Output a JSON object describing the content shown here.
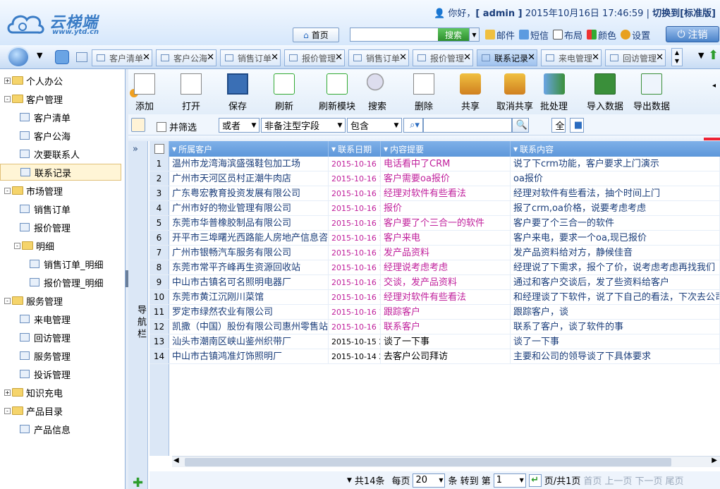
{
  "brand": {
    "name": "云梯端",
    "url": "www.ytd.cn"
  },
  "header": {
    "greeting": "你好，",
    "user": "[ admin ]",
    "datetime": "2015年10月16日 17:46:59",
    "separator": "|",
    "switch_label": "切换到[标准版]",
    "home": "首页",
    "search_placeholder": "",
    "search_button": "搜索",
    "actions": [
      "邮件",
      "短信",
      "布局",
      "颜色",
      "设置"
    ],
    "logout": "注销"
  },
  "tabs": [
    {
      "label": "客户清单"
    },
    {
      "label": "客户公海"
    },
    {
      "label": "销售订单"
    },
    {
      "label": "报价管理"
    },
    {
      "label": "销售订单"
    },
    {
      "label": "报价管理"
    },
    {
      "label": "联系记录",
      "active": true
    },
    {
      "label": "来电管理"
    },
    {
      "label": "回访管理"
    }
  ],
  "sidebar": {
    "items": [
      {
        "label": "个人办公",
        "type": "folder",
        "expand": "+",
        "indent": 0
      },
      {
        "label": "客户管理",
        "type": "folder",
        "expand": "-",
        "indent": 0
      },
      {
        "label": "客户清单",
        "type": "page",
        "indent": 1
      },
      {
        "label": "客户公海",
        "type": "page",
        "indent": 1
      },
      {
        "label": "次要联系人",
        "type": "page",
        "indent": 1
      },
      {
        "label": "联系记录",
        "type": "page",
        "indent": 1,
        "selected": true
      },
      {
        "label": "市场管理",
        "type": "folder",
        "expand": "-",
        "indent": 0
      },
      {
        "label": "销售订单",
        "type": "page",
        "indent": 1
      },
      {
        "label": "报价管理",
        "type": "page",
        "indent": 1
      },
      {
        "label": "明细",
        "type": "folder",
        "expand": "-",
        "indent": 1
      },
      {
        "label": "销售订单_明细",
        "type": "page",
        "indent": 2
      },
      {
        "label": "报价管理_明细",
        "type": "page",
        "indent": 2
      },
      {
        "label": "服务管理",
        "type": "folder",
        "expand": "-",
        "indent": 0
      },
      {
        "label": "来电管理",
        "type": "page",
        "indent": 1
      },
      {
        "label": "回访管理",
        "type": "page",
        "indent": 1
      },
      {
        "label": "服务管理",
        "type": "page",
        "indent": 1
      },
      {
        "label": "投诉管理",
        "type": "page",
        "indent": 1
      },
      {
        "label": "知识充电",
        "type": "folder",
        "expand": "+",
        "indent": 0
      },
      {
        "label": "产品目录",
        "type": "folder",
        "expand": "-",
        "indent": 0
      },
      {
        "label": "产品信息",
        "type": "page",
        "indent": 1
      }
    ]
  },
  "toolbar": {
    "buttons": [
      {
        "label": "添加",
        "icon": "new-document-icon"
      },
      {
        "label": "打开",
        "icon": "edit-document-icon"
      },
      {
        "label": "保存",
        "icon": "floppy-disk-icon"
      },
      {
        "label": "刷新",
        "icon": "refresh-icon"
      },
      {
        "label": "刷新模块",
        "icon": "refresh-module-icon"
      },
      {
        "label": "搜索",
        "icon": "magnifier-icon"
      },
      {
        "label": "删除",
        "icon": "delete-icon"
      },
      {
        "label": "共享",
        "icon": "share-icon"
      },
      {
        "label": "取消共享",
        "icon": "unshare-icon"
      },
      {
        "label": "批处理",
        "icon": "batch-icon"
      },
      {
        "label": "导入数据",
        "icon": "import-excel-icon"
      },
      {
        "label": "导出数据",
        "icon": "export-excel-icon"
      }
    ]
  },
  "filter": {
    "combine_label": "并筛选",
    "logic": "或者",
    "field": "非备注型字段",
    "operator": "包含",
    "value": ""
  },
  "grid": {
    "nav_label": "导航栏",
    "columns": [
      "所属客户",
      "联系日期",
      "内容提要",
      "联系内容"
    ],
    "rows": [
      {
        "n": "1",
        "customer": "温州市龙湾海滨盛强鞋包加工场",
        "date": "2015-10-16",
        "summary": "电话看中了CRM",
        "content": "说了下crm功能，客户要求上门演示",
        "plain": false
      },
      {
        "n": "2",
        "customer": "广州市天河区员村正潮牛肉店",
        "date": "2015-10-16 14",
        "summary": "客户需要oa报价",
        "content": "oa报价",
        "plain": false
      },
      {
        "n": "3",
        "customer": "广东粤宏教育投资发展有限公司",
        "date": "2015-10-16 14",
        "summary": "经理对软件有些看法",
        "content": "经理对软件有些看法，抽个时间上门",
        "plain": false
      },
      {
        "n": "4",
        "customer": "广州市好的物业管理有限公司",
        "date": "2015-10-16 14",
        "summary": "报价",
        "content": "报了crm,oa价格，说要考虑考虑",
        "plain": false
      },
      {
        "n": "5",
        "customer": "东莞市华普橡胶制品有限公司",
        "date": "2015-10-16 14",
        "summary": "客户要了个三合一的软件",
        "content": "客户要了个三合一的软件",
        "plain": false
      },
      {
        "n": "6",
        "customer": "开平市三埠曙光西路能人房地产信息咨",
        "date": "2015-10-16 14",
        "summary": "客户来电",
        "content": "客户来电，要求一个oa,现已报价",
        "plain": false
      },
      {
        "n": "7",
        "customer": "广州市银畅汽车服务有限公司",
        "date": "2015-10-16 14",
        "summary": "发产品资料",
        "content": "发产品资料给对方，静候佳音",
        "plain": false
      },
      {
        "n": "8",
        "customer": "东莞市常平齐峰再生资源回收站",
        "date": "2015-10-16 14",
        "summary": "经理说考虑考虑",
        "content": "经理说了下需求，报个了价，说考虑考虑再找我们",
        "plain": false
      },
      {
        "n": "9",
        "customer": "中山市古镇名可名照明电器厂",
        "date": "2015-10-16 14",
        "summary": "交谈，发产品资料",
        "content": "通过和客户交谈后，发了些资料给客户",
        "plain": false
      },
      {
        "n": "10",
        "customer": "东莞市黄江沉刚川菜馆",
        "date": "2015-10-16 10",
        "summary": "经理对软件有些看法",
        "content": "和经理谈了下软件，说了下自己的看法，下次去公司",
        "plain": false
      },
      {
        "n": "11",
        "customer": "罗定市绿然农业有限公司",
        "date": "2015-10-16 10",
        "summary": "跟踪客户",
        "content": "跟踪客户，谈",
        "plain": false
      },
      {
        "n": "12",
        "customer": "凯撒（中国）股份有限公司惠州零售站",
        "date": "2015-10-16 10",
        "summary": "联系客户",
        "content": "联系了客户，谈了软件的事",
        "plain": false
      },
      {
        "n": "13",
        "customer": "汕头市潮南区峡山鉴州织带厂",
        "date": "2015-10-15 23",
        "summary": "谈了一下事",
        "content": "谈了一下事",
        "plain": true
      },
      {
        "n": "14",
        "customer": "中山市古镇鸿准灯饰照明厂",
        "date": "2015-10-14 21",
        "summary": "去客户公司拜访",
        "content": "主要和公司的领导谈了下具体要求",
        "plain": true
      }
    ]
  },
  "pager": {
    "total": "共14条",
    "per_page_label": "每页",
    "per_page": "20",
    "goto_label": "条 转到 第",
    "page": "1",
    "page_info": "页/共1页",
    "first": "首页",
    "prev": "上一页",
    "next": "下一页",
    "last": "尾页"
  },
  "colors": {
    "accent": "#5d97da",
    "highlight_text": "#c0209c",
    "link_text": "#1a3d7a"
  }
}
